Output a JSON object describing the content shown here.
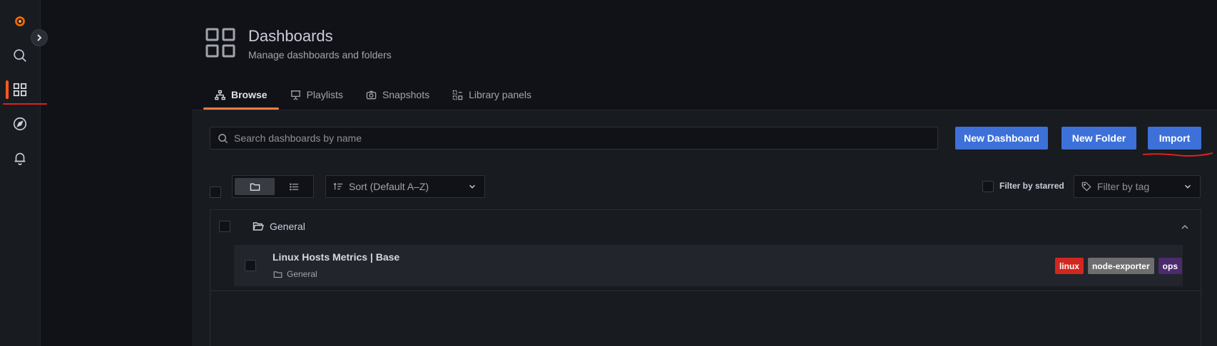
{
  "header": {
    "title": "Dashboards",
    "subtitle": "Manage dashboards and folders"
  },
  "tabs": [
    {
      "label": "Browse",
      "icon": "sitemap-icon",
      "active": true
    },
    {
      "label": "Playlists",
      "icon": "presentation-icon",
      "active": false
    },
    {
      "label": "Snapshots",
      "icon": "camera-icon",
      "active": false
    },
    {
      "label": "Library panels",
      "icon": "library-panels-icon",
      "active": false
    }
  ],
  "search": {
    "placeholder": "Search dashboards by name"
  },
  "actions": {
    "new_dashboard": "New Dashboard",
    "new_folder": "New Folder",
    "import": "Import"
  },
  "sort": {
    "label": "Sort (Default A–Z)"
  },
  "filters": {
    "starred_label": "Filter by starred",
    "tag_placeholder": "Filter by tag"
  },
  "folders": [
    {
      "name": "General",
      "dashboards": [
        {
          "title": "Linux Hosts Metrics | Base",
          "folder": "General",
          "tags": [
            {
              "label": "linux",
              "color": "#d0271f"
            },
            {
              "label": "node-exporter",
              "color": "#6e6e6e"
            },
            {
              "label": "ops",
              "color": "#4b2a6e"
            }
          ]
        }
      ]
    }
  ],
  "colors": {
    "accent": "#ff7a45",
    "primary_button": "#3d71d9",
    "annotation": "#e02020"
  }
}
